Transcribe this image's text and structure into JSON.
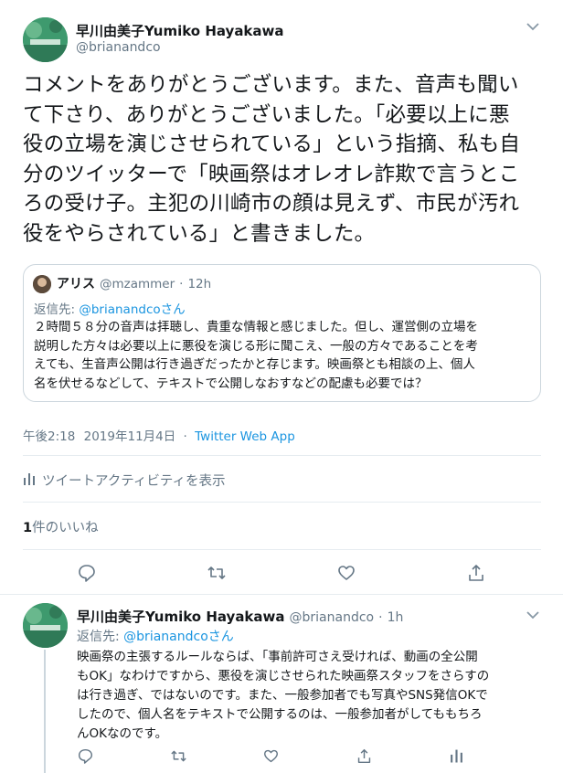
{
  "tweet": {
    "author_name": "早川由美子Yumiko Hayakawa",
    "author_handle": "@brianandco",
    "text_lines": [
      "コメントをありがとうございます。また、音声も聞い",
      "て下さり、ありがとうございました。「必要以上に悪",
      "役の立場を演じさせられている」という指摘、私も自",
      "分のツイッターで「映画祭はオレオレ詐欺で言うとこ",
      "ろの受け子。主犯の川崎市の顔は見えず、市民が汚れ",
      "役をやらされている」と書きました。"
    ],
    "time": "午後2:18",
    "date": "2019年11月4日",
    "separator": "·",
    "client": "Twitter Web App",
    "activity_label": "ツイートアクティビティを表示",
    "likes_count": "1",
    "likes_label": "件のいいね"
  },
  "quote": {
    "author_name": "アリス",
    "author_handle": "@mzammer",
    "separator": "·",
    "time": "12h",
    "reply_prefix": "返信先: ",
    "reply_target": "@brianandco",
    "reply_suffix": "さん",
    "text_lines": [
      "２時間５８分の音声は拝聴し、貴重な情報と感じました。但し、運営側の立場を",
      "説明した方々は必要以上に悪役を演じる形に聞こえ、一般の方々であることを考",
      "えても、生音声公開は行き過ぎだったかと存じます。映画祭とも相談の上、個人",
      "名を伏せるなどして、テキストで公開しなおすなどの配慮も必要では？"
    ]
  },
  "reply": {
    "author_name": "早川由美子Yumiko Hayakawa",
    "author_handle": "@brianandco",
    "separator": "·",
    "time": "1h",
    "reply_prefix": "返信先: ",
    "reply_target": "@brianandco",
    "reply_suffix": "さん",
    "text_lines": [
      "映画祭の主張するルールならば、「事前許可さえ受ければ、動画の全公開",
      "もOK」なわけですから、悪役を演じさせられた映画祭スタッフをさらすの",
      "は行き過ぎ、ではないのです。また、一般参加者でも写真やSNS発信OKで",
      "したので、個人名をテキストで公開するのは、一般参加者がしてももちろ",
      "んOKなのです。"
    ]
  },
  "colors": {
    "accent": "#1b95e0",
    "secondary_text": "#657786",
    "divider": "#e6ecf0"
  },
  "icons": {
    "chevron": "chevron-down-icon",
    "activity": "bar-chart-icon",
    "reply": "reply-icon",
    "retweet": "retweet-icon",
    "like": "heart-icon",
    "share": "share-icon",
    "analytics": "analytics-icon"
  }
}
